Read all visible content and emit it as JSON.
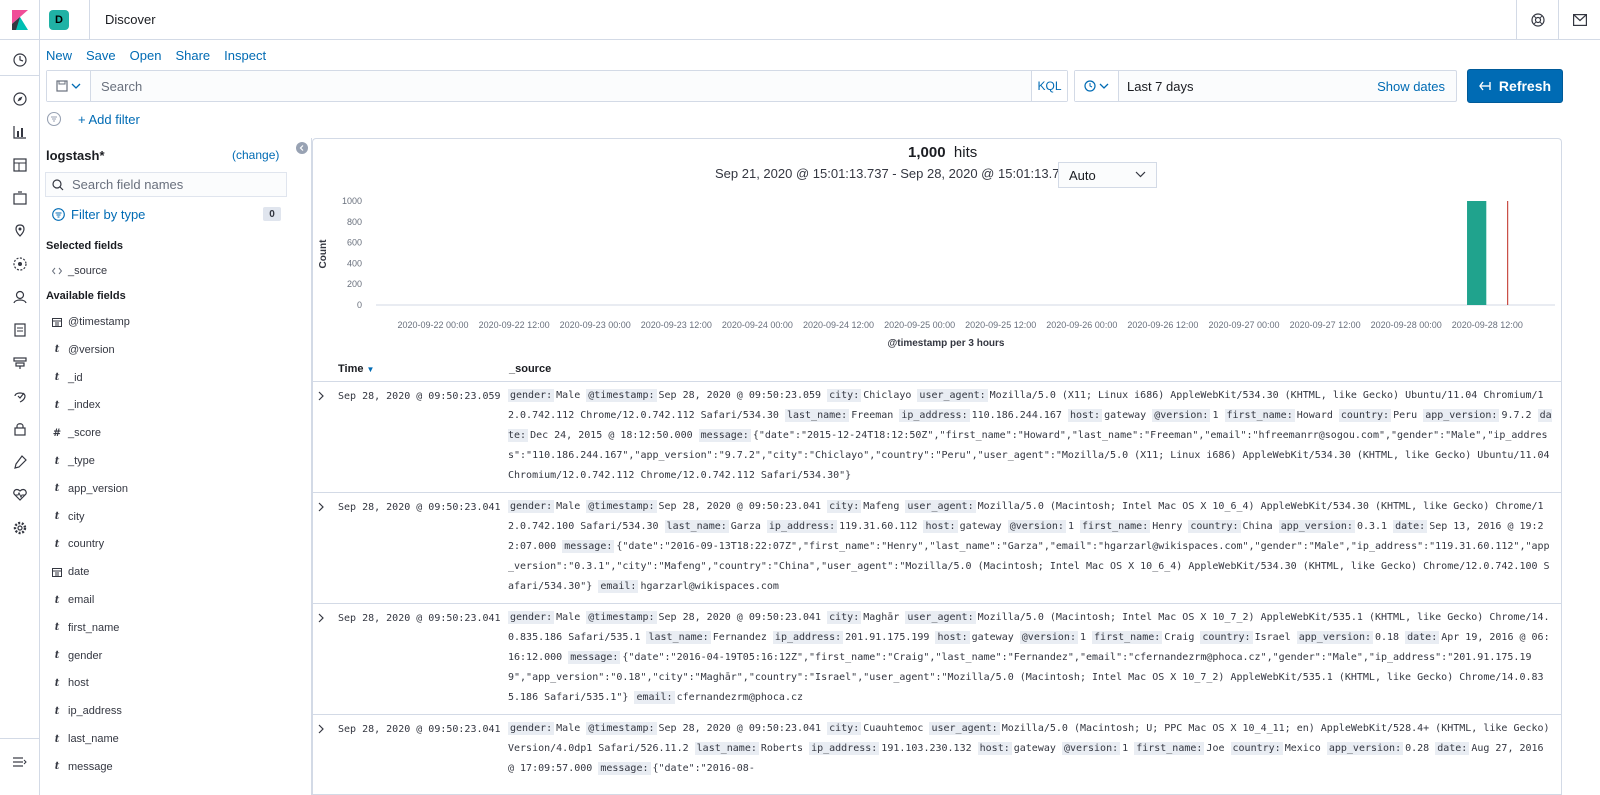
{
  "header": {
    "space_initial": "D",
    "app_title": "Discover"
  },
  "menu": [
    "New",
    "Save",
    "Open",
    "Share",
    "Inspect"
  ],
  "query": {
    "placeholder": "Search",
    "language": "KQL"
  },
  "datepicker": {
    "range": "Last 7 days",
    "show_dates": "Show dates"
  },
  "refresh_label": "Refresh",
  "add_filter": "+ Add filter",
  "sidebar": {
    "index_pattern": "logstash*",
    "change_label": "(change)",
    "search_placeholder": "Search field names",
    "filter_by_type": "Filter by type",
    "filter_count": "0",
    "selected_title": "Selected fields",
    "selected_fields": [
      {
        "type": "</>",
        "name": "_source"
      }
    ],
    "available_title": "Available fields",
    "available_fields": [
      {
        "type": "cal",
        "name": "@timestamp"
      },
      {
        "type": "t",
        "name": "@version"
      },
      {
        "type": "t",
        "name": "_id"
      },
      {
        "type": "t",
        "name": "_index"
      },
      {
        "type": "#",
        "name": "_score"
      },
      {
        "type": "t",
        "name": "_type"
      },
      {
        "type": "t",
        "name": "app_version"
      },
      {
        "type": "t",
        "name": "city"
      },
      {
        "type": "t",
        "name": "country"
      },
      {
        "type": "cal",
        "name": "date"
      },
      {
        "type": "t",
        "name": "email"
      },
      {
        "type": "t",
        "name": "first_name"
      },
      {
        "type": "t",
        "name": "gender"
      },
      {
        "type": "t",
        "name": "host"
      },
      {
        "type": "t",
        "name": "ip_address"
      },
      {
        "type": "t",
        "name": "last_name"
      },
      {
        "type": "t",
        "name": "message"
      }
    ]
  },
  "results": {
    "hits_count": "1,000",
    "hits_label": "hits",
    "time_range": "Sep 21, 2020 @ 15:01:13.737 - Sep 28, 2020 @ 15:01:13.737 —",
    "interval": "Auto"
  },
  "chart_data": {
    "type": "bar",
    "xlabel": "@timestamp per 3 hours",
    "ylabel": "Count",
    "ylim": [
      0,
      1000
    ],
    "y_ticks": [
      "0",
      "200",
      "400",
      "600",
      "800",
      "1000"
    ],
    "x_ticks": [
      "2020-09-22 00:00",
      "2020-09-22 12:00",
      "2020-09-23 00:00",
      "2020-09-23 12:00",
      "2020-09-24 00:00",
      "2020-09-24 12:00",
      "2020-09-25 00:00",
      "2020-09-25 12:00",
      "2020-09-26 00:00",
      "2020-09-26 12:00",
      "2020-09-27 00:00",
      "2020-09-27 12:00",
      "2020-09-28 00:00",
      "2020-09-28 12:00"
    ],
    "bars": [
      {
        "x": "2020-09-28 09:00",
        "value": 1000
      }
    ],
    "now_marker": "2020-09-28 15:01",
    "bar_color": "#20a38d",
    "marker_color": "#bd271e"
  },
  "table": {
    "col_time": "Time",
    "col_source": "_source",
    "rows": [
      {
        "time": "Sep 28, 2020 @ 09:50:23.059",
        "fields": [
          [
            "gender:",
            "Male"
          ],
          [
            "@timestamp:",
            "Sep 28, 2020 @ 09:50:23.059"
          ],
          [
            "city:",
            "Chiclayo"
          ],
          [
            "user_agent:",
            "Mozilla/5.0 (X11; Linux i686) AppleWebKit/534.30 (KHTML, like Gecko) Ubuntu/11.04 Chromium/12.0.742.112 Chrome/12.0.742.112 Safari/534.30"
          ],
          [
            "last_name:",
            "Freeman"
          ],
          [
            "ip_address:",
            "110.186.244.167"
          ],
          [
            "host:",
            "gateway"
          ],
          [
            "@version:",
            "1"
          ],
          [
            "first_name:",
            "Howard"
          ],
          [
            "country:",
            "Peru"
          ],
          [
            "app_version:",
            "9.7.2"
          ],
          [
            "date:",
            "Dec 24, 2015 @ 18:12:50.000"
          ],
          [
            "message:",
            "{\"date\":\"2015-12-24T18:12:50Z\",\"first_name\":\"Howard\",\"last_name\":\"Freeman\",\"email\":\"hfreemanrr@sogou.com\",\"gender\":\"Male\",\"ip_address\":\"110.186.244.167\",\"app_version\":\"9.7.2\",\"city\":\"Chiclayo\",\"country\":\"Peru\",\"user_agent\":\"Mozilla/5.0 (X11; Linux i686) AppleWebKit/534.30 (KHTML, like Gecko) Ubuntu/11.04 Chromium/12.0.742.112 Chrome/12.0.742.112 Safari/534.30\"}"
          ]
        ]
      },
      {
        "time": "Sep 28, 2020 @ 09:50:23.041",
        "fields": [
          [
            "gender:",
            "Male"
          ],
          [
            "@timestamp:",
            "Sep 28, 2020 @ 09:50:23.041"
          ],
          [
            "city:",
            "Mafeng"
          ],
          [
            "user_agent:",
            "Mozilla/5.0 (Macintosh; Intel Mac OS X 10_6_4) AppleWebKit/534.30 (KHTML, like Gecko) Chrome/12.0.742.100 Safari/534.30"
          ],
          [
            "last_name:",
            "Garza"
          ],
          [
            "ip_address:",
            "119.31.60.112"
          ],
          [
            "host:",
            "gateway"
          ],
          [
            "@version:",
            "1"
          ],
          [
            "first_name:",
            "Henry"
          ],
          [
            "country:",
            "China"
          ],
          [
            "app_version:",
            "0.3.1"
          ],
          [
            "date:",
            "Sep 13, 2016 @ 19:22:07.000"
          ],
          [
            "message:",
            "{\"date\":\"2016-09-13T18:22:07Z\",\"first_name\":\"Henry\",\"last_name\":\"Garza\",\"email\":\"hgarzarl@wikispaces.com\",\"gender\":\"Male\",\"ip_address\":\"119.31.60.112\",\"app_version\":\"0.3.1\",\"city\":\"Mafeng\",\"country\":\"China\",\"user_agent\":\"Mozilla/5.0 (Macintosh; Intel Mac OS X 10_6_4) AppleWebKit/534.30 (KHTML, like Gecko) Chrome/12.0.742.100 Safari/534.30\"}"
          ],
          [
            "email:",
            "hgarzarl@wikispaces.com"
          ]
        ]
      },
      {
        "time": "Sep 28, 2020 @ 09:50:23.041",
        "fields": [
          [
            "gender:",
            "Male"
          ],
          [
            "@timestamp:",
            "Sep 28, 2020 @ 09:50:23.041"
          ],
          [
            "city:",
            "Maghār"
          ],
          [
            "user_agent:",
            "Mozilla/5.0 (Macintosh; Intel Mac OS X 10_7_2) AppleWebKit/535.1 (KHTML, like Gecko) Chrome/14.0.835.186 Safari/535.1"
          ],
          [
            "last_name:",
            "Fernandez"
          ],
          [
            "ip_address:",
            "201.91.175.199"
          ],
          [
            "host:",
            "gateway"
          ],
          [
            "@version:",
            "1"
          ],
          [
            "first_name:",
            "Craig"
          ],
          [
            "country:",
            "Israel"
          ],
          [
            "app_version:",
            "0.18"
          ],
          [
            "date:",
            "Apr 19, 2016 @ 06:16:12.000"
          ],
          [
            "message:",
            "{\"date\":\"2016-04-19T05:16:12Z\",\"first_name\":\"Craig\",\"last_name\":\"Fernandez\",\"email\":\"cfernandezrm@phoca.cz\",\"gender\":\"Male\",\"ip_address\":\"201.91.175.199\",\"app_version\":\"0.18\",\"city\":\"Maghār\",\"country\":\"Israel\",\"user_agent\":\"Mozilla/5.0 (Macintosh; Intel Mac OS X 10_7_2) AppleWebKit/535.1 (KHTML, like Gecko) Chrome/14.0.835.186 Safari/535.1\"}"
          ],
          [
            "email:",
            "cfernandezrm@phoca.cz"
          ]
        ]
      },
      {
        "time": "Sep 28, 2020 @ 09:50:23.041",
        "fields": [
          [
            "gender:",
            "Male"
          ],
          [
            "@timestamp:",
            "Sep 28, 2020 @ 09:50:23.041"
          ],
          [
            "city:",
            "Cuauhtemoc"
          ],
          [
            "user_agent:",
            "Mozilla/5.0 (Macintosh; U; PPC Mac OS X 10_4_11; en) AppleWebKit/528.4+ (KHTML, like Gecko) Version/4.0dp1 Safari/526.11.2"
          ],
          [
            "last_name:",
            "Roberts"
          ],
          [
            "ip_address:",
            "191.103.230.132"
          ],
          [
            "host:",
            "gateway"
          ],
          [
            "@version:",
            "1"
          ],
          [
            "first_name:",
            "Joe"
          ],
          [
            "country:",
            "Mexico"
          ],
          [
            "app_version:",
            "0.28"
          ],
          [
            "date:",
            "Aug 27, 2016 @ 17:09:57.000"
          ],
          [
            "message:",
            "{\"date\":\"2016-08-"
          ]
        ]
      }
    ]
  }
}
